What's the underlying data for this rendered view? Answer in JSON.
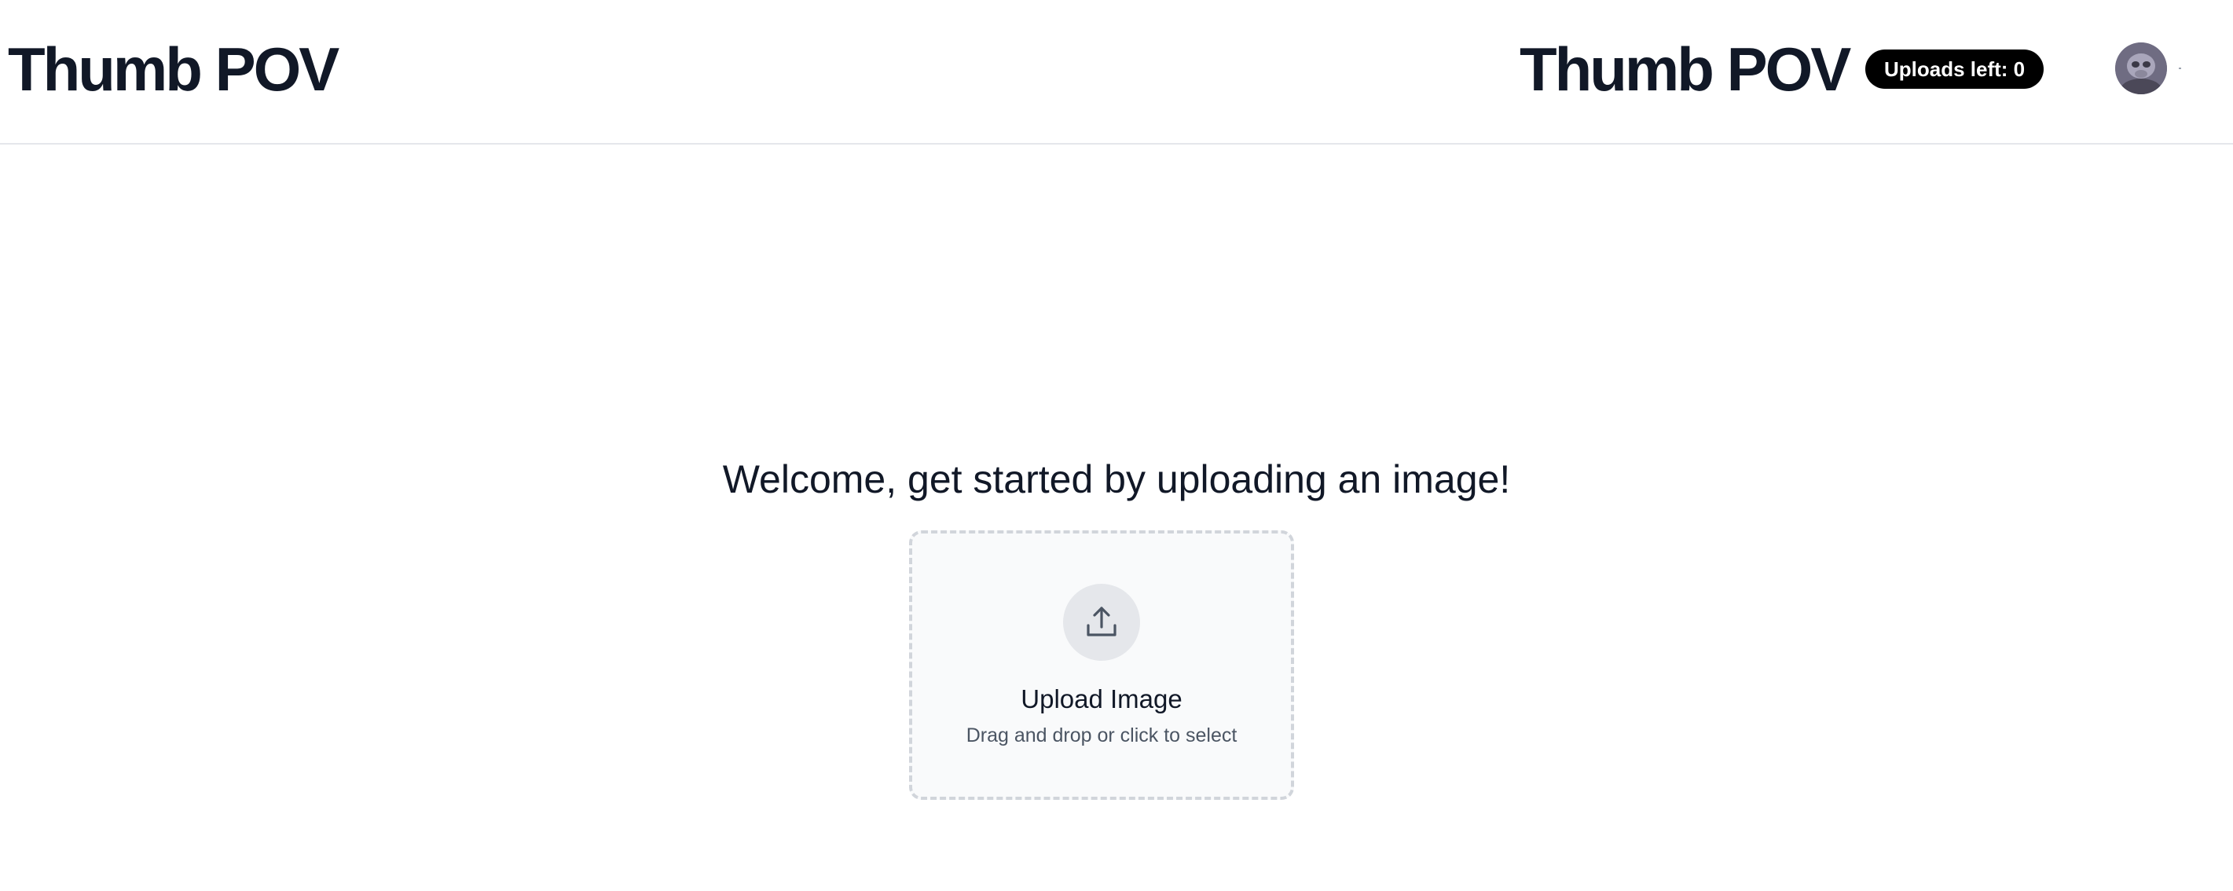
{
  "header": {
    "brand_left": "Thumb POV",
    "brand_right": "Thumb POV",
    "uploads_badge": "Uploads left: 0",
    "avatar_icon": "user-avatar"
  },
  "main": {
    "welcome": "Welcome, get started by uploading an image!",
    "dropzone": {
      "icon": "upload-icon",
      "title": "Upload Image",
      "subtitle": "Drag and drop or click to select"
    }
  },
  "colors": {
    "text_primary": "#111827",
    "badge_bg": "#000000",
    "dropzone_bg": "#f9fafb",
    "dropzone_border": "#d1d5db",
    "icon_circle": "#e5e7eb",
    "icon_stroke": "#4b5563"
  }
}
